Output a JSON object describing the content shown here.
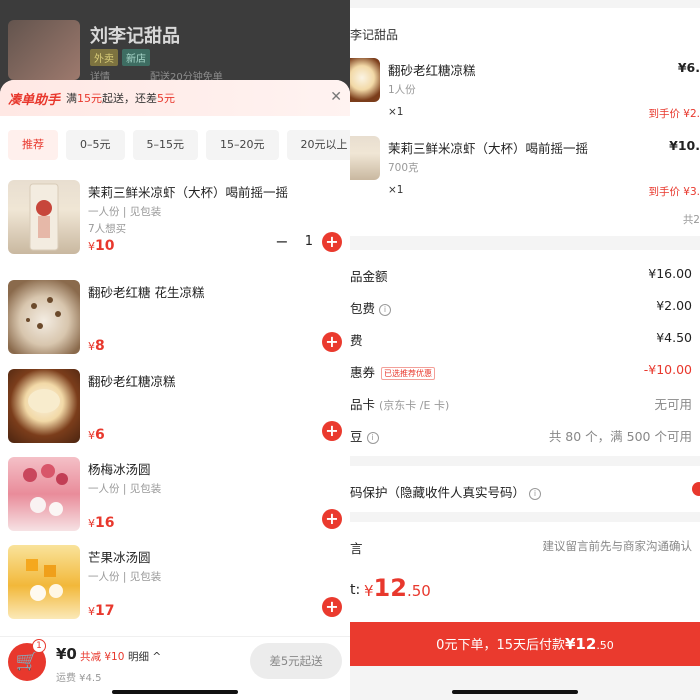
{
  "left": {
    "store": {
      "name": "刘李记甜品",
      "tags": [
        "外卖",
        "新店"
      ],
      "sub": [
        "详情",
        "配送20分钟免单"
      ]
    },
    "helper": {
      "title": "凑单助手",
      "text_pre": "满",
      "threshold": "15元",
      "text_mid": "起送，还差",
      "diff": "5元",
      "close_icon": "close-icon"
    },
    "filters": [
      "推荐",
      "0–5元",
      "5–15元",
      "15–20元",
      "20元以上"
    ],
    "products": [
      {
        "name": "茉莉三鲜米凉虾（大杯）喝前摇一摇",
        "desc": "一人份 | 见包装",
        "want": "7人想买",
        "price": "10",
        "qty": "1",
        "image": "milk-tea-cup"
      },
      {
        "name": "翻砂老红糖 花生凉糕",
        "desc": "",
        "want": "",
        "price": "8",
        "image": "peanut-jelly"
      },
      {
        "name": "翻砂老红糖凉糕",
        "desc": "",
        "want": "",
        "price": "6",
        "image": "brown-sugar-jelly"
      },
      {
        "name": "杨梅冰汤圆",
        "desc": "一人份 | 见包装",
        "want": "",
        "price": "16",
        "image": "bayberry-dumplings"
      },
      {
        "name": "芒果冰汤圆",
        "desc": "一人份 | 见包装",
        "want": "",
        "price": "17",
        "image": "mango-dumplings"
      }
    ],
    "cart": {
      "badge": "1",
      "total": "¥0",
      "discount": "共减 ¥10",
      "detail": "明细 ^",
      "fee": "运费 ¥4.5",
      "button": "差5元起送"
    }
  },
  "right": {
    "store_name": "李记甜品",
    "items": [
      {
        "name": "翻砂老红糖凉糕",
        "desc": "1人份",
        "qty": "×1",
        "price": "¥6.",
        "deal": "到手价 ¥2.",
        "image": "brown-sugar-jelly"
      },
      {
        "name": "茉莉三鲜米凉虾（大杯）喝前摇一摇",
        "desc": "700克",
        "qty": "×1",
        "price": "¥10.",
        "deal": "到手价 ¥3.",
        "image": "milk-tea-cup"
      }
    ],
    "count": "共2",
    "rows": [
      {
        "label": "品金额",
        "value": "¥16.00"
      },
      {
        "label": "包费",
        "value": "¥2.00",
        "info": "i"
      },
      {
        "label": "费",
        "value": "¥4.50"
      },
      {
        "label": "惠券",
        "badge": "已选推荐优惠",
        "value": "-¥10.00"
      },
      {
        "label": "品卡",
        "sublabel": "(京东卡 /E 卡)",
        "value": "无可用"
      },
      {
        "label": "豆",
        "info": "i",
        "value": "共 80 个，满 500 个可用"
      }
    ],
    "privacy": "码保护（隐藏收件人真实号码）",
    "note_label": "言",
    "note_placeholder": "建议留言前先与商家沟通确认",
    "pay_label": "t:",
    "pay_currency": "¥",
    "pay_int": "12",
    "pay_dec": ".50",
    "pay_button_text": "0元下单，15天后付款",
    "pay_button_amount": "¥12",
    "pay_button_dec": ".50"
  },
  "colors": {
    "accent": "#e8382d",
    "overlay": "#3c3c3c"
  }
}
